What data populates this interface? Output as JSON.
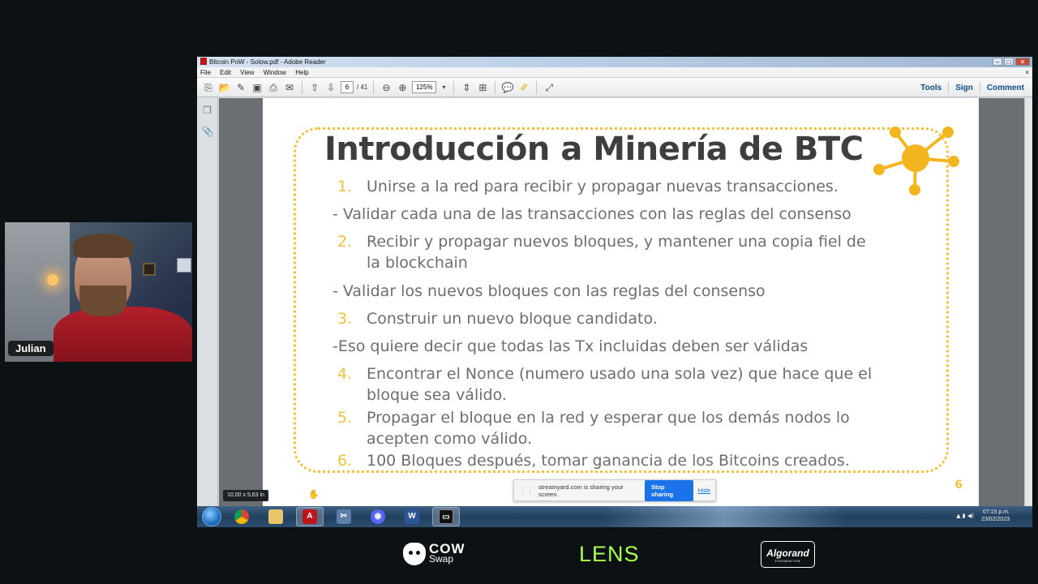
{
  "webcam": {
    "name": "Julian"
  },
  "reader": {
    "title": "Bitcoin PoW - Solow.pdf - Adobe Reader",
    "menu": [
      "File",
      "Edit",
      "View",
      "Window",
      "Help"
    ],
    "menu_close": "×",
    "page_current": "6",
    "page_total": "/ 41",
    "zoom": "125%",
    "right_tools": [
      "Tools",
      "Sign",
      "Comment"
    ]
  },
  "slide": {
    "title": "Introducción a Minería de BTC",
    "items": [
      {
        "num": "1.",
        "text": "Unirse a la red para recibir y propagar nuevas transacciones."
      },
      {
        "num": "",
        "text": "- Validar cada una de las transacciones con las reglas del consenso"
      },
      {
        "num": "2.",
        "text": "Recibir y propagar nuevos bloques, y mantener una copia fiel de"
      },
      {
        "num": "",
        "text": "la blockchain"
      },
      {
        "num": "",
        "text": "- Validar los nuevos bloques con las reglas del consenso"
      },
      {
        "num": "3.",
        "text": "Construir un nuevo bloque candidato."
      },
      {
        "num": "",
        "text": "-Eso quiere decir que todas las Tx incluidas deben ser válidas"
      },
      {
        "num": "4.",
        "text": "Encontrar el Nonce (numero usado una sola vez) que hace que el"
      },
      {
        "num": "",
        "text": "bloque sea válido."
      },
      {
        "num": "5.",
        "text": "Propagar el bloque en la red y esperar que los demás nodos lo"
      },
      {
        "num": "",
        "text": "acepten como válido."
      },
      {
        "num": "6.",
        "text": "100 Bloques después, tomar ganancia de los Bitcoins creados."
      }
    ],
    "page_number": "6",
    "accent_color": "#f3c13a"
  },
  "overlays": {
    "dimensions": "10,00 x 5,63 in",
    "share_message": "streamyard.com is sharing your screen.",
    "stop_sharing": "Stop sharing",
    "hide": "Hide"
  },
  "taskbar": {
    "apps": [
      "chrome-icon",
      "folder-icon",
      "adobe-reader-icon",
      "snipping-icon",
      "discord-icon",
      "word-icon",
      "terminal-icon"
    ],
    "time": "07:15 p.m.",
    "date": "23/02/2023"
  },
  "sponsors": {
    "cow_main": "COW",
    "cow_sub": "Swap",
    "lens": "LENS",
    "algorand_main": "Algorand",
    "algorand_sub": "FOUNDATION"
  }
}
